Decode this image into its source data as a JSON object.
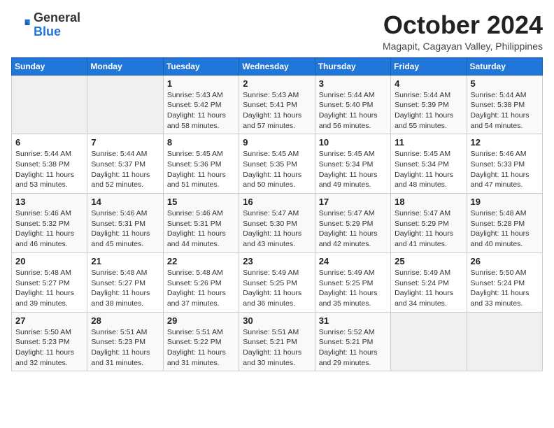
{
  "header": {
    "logo_general": "General",
    "logo_blue": "Blue",
    "month_title": "October 2024",
    "subtitle": "Magapit, Cagayan Valley, Philippines"
  },
  "weekdays": [
    "Sunday",
    "Monday",
    "Tuesday",
    "Wednesday",
    "Thursday",
    "Friday",
    "Saturday"
  ],
  "weeks": [
    [
      {
        "day": "",
        "info": ""
      },
      {
        "day": "",
        "info": ""
      },
      {
        "day": "1",
        "info": "Sunrise: 5:43 AM\nSunset: 5:42 PM\nDaylight: 11 hours and 58 minutes."
      },
      {
        "day": "2",
        "info": "Sunrise: 5:43 AM\nSunset: 5:41 PM\nDaylight: 11 hours and 57 minutes."
      },
      {
        "day": "3",
        "info": "Sunrise: 5:44 AM\nSunset: 5:40 PM\nDaylight: 11 hours and 56 minutes."
      },
      {
        "day": "4",
        "info": "Sunrise: 5:44 AM\nSunset: 5:39 PM\nDaylight: 11 hours and 55 minutes."
      },
      {
        "day": "5",
        "info": "Sunrise: 5:44 AM\nSunset: 5:38 PM\nDaylight: 11 hours and 54 minutes."
      }
    ],
    [
      {
        "day": "6",
        "info": "Sunrise: 5:44 AM\nSunset: 5:38 PM\nDaylight: 11 hours and 53 minutes."
      },
      {
        "day": "7",
        "info": "Sunrise: 5:44 AM\nSunset: 5:37 PM\nDaylight: 11 hours and 52 minutes."
      },
      {
        "day": "8",
        "info": "Sunrise: 5:45 AM\nSunset: 5:36 PM\nDaylight: 11 hours and 51 minutes."
      },
      {
        "day": "9",
        "info": "Sunrise: 5:45 AM\nSunset: 5:35 PM\nDaylight: 11 hours and 50 minutes."
      },
      {
        "day": "10",
        "info": "Sunrise: 5:45 AM\nSunset: 5:34 PM\nDaylight: 11 hours and 49 minutes."
      },
      {
        "day": "11",
        "info": "Sunrise: 5:45 AM\nSunset: 5:34 PM\nDaylight: 11 hours and 48 minutes."
      },
      {
        "day": "12",
        "info": "Sunrise: 5:46 AM\nSunset: 5:33 PM\nDaylight: 11 hours and 47 minutes."
      }
    ],
    [
      {
        "day": "13",
        "info": "Sunrise: 5:46 AM\nSunset: 5:32 PM\nDaylight: 11 hours and 46 minutes."
      },
      {
        "day": "14",
        "info": "Sunrise: 5:46 AM\nSunset: 5:31 PM\nDaylight: 11 hours and 45 minutes."
      },
      {
        "day": "15",
        "info": "Sunrise: 5:46 AM\nSunset: 5:31 PM\nDaylight: 11 hours and 44 minutes."
      },
      {
        "day": "16",
        "info": "Sunrise: 5:47 AM\nSunset: 5:30 PM\nDaylight: 11 hours and 43 minutes."
      },
      {
        "day": "17",
        "info": "Sunrise: 5:47 AM\nSunset: 5:29 PM\nDaylight: 11 hours and 42 minutes."
      },
      {
        "day": "18",
        "info": "Sunrise: 5:47 AM\nSunset: 5:29 PM\nDaylight: 11 hours and 41 minutes."
      },
      {
        "day": "19",
        "info": "Sunrise: 5:48 AM\nSunset: 5:28 PM\nDaylight: 11 hours and 40 minutes."
      }
    ],
    [
      {
        "day": "20",
        "info": "Sunrise: 5:48 AM\nSunset: 5:27 PM\nDaylight: 11 hours and 39 minutes."
      },
      {
        "day": "21",
        "info": "Sunrise: 5:48 AM\nSunset: 5:27 PM\nDaylight: 11 hours and 38 minutes."
      },
      {
        "day": "22",
        "info": "Sunrise: 5:48 AM\nSunset: 5:26 PM\nDaylight: 11 hours and 37 minutes."
      },
      {
        "day": "23",
        "info": "Sunrise: 5:49 AM\nSunset: 5:25 PM\nDaylight: 11 hours and 36 minutes."
      },
      {
        "day": "24",
        "info": "Sunrise: 5:49 AM\nSunset: 5:25 PM\nDaylight: 11 hours and 35 minutes."
      },
      {
        "day": "25",
        "info": "Sunrise: 5:49 AM\nSunset: 5:24 PM\nDaylight: 11 hours and 34 minutes."
      },
      {
        "day": "26",
        "info": "Sunrise: 5:50 AM\nSunset: 5:24 PM\nDaylight: 11 hours and 33 minutes."
      }
    ],
    [
      {
        "day": "27",
        "info": "Sunrise: 5:50 AM\nSunset: 5:23 PM\nDaylight: 11 hours and 32 minutes."
      },
      {
        "day": "28",
        "info": "Sunrise: 5:51 AM\nSunset: 5:23 PM\nDaylight: 11 hours and 31 minutes."
      },
      {
        "day": "29",
        "info": "Sunrise: 5:51 AM\nSunset: 5:22 PM\nDaylight: 11 hours and 31 minutes."
      },
      {
        "day": "30",
        "info": "Sunrise: 5:51 AM\nSunset: 5:21 PM\nDaylight: 11 hours and 30 minutes."
      },
      {
        "day": "31",
        "info": "Sunrise: 5:52 AM\nSunset: 5:21 PM\nDaylight: 11 hours and 29 minutes."
      },
      {
        "day": "",
        "info": ""
      },
      {
        "day": "",
        "info": ""
      }
    ]
  ]
}
